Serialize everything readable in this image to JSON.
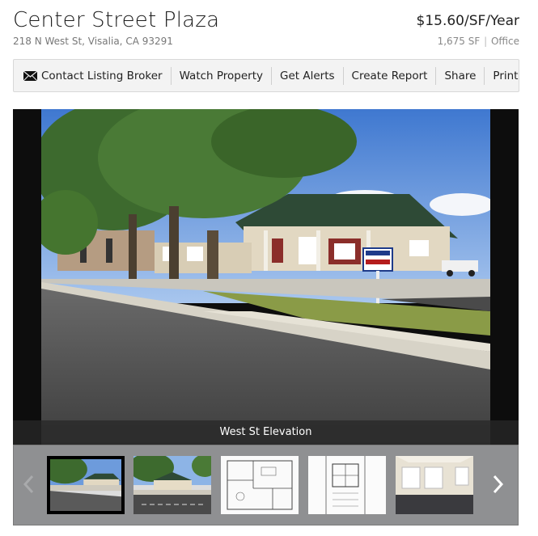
{
  "listing": {
    "title": "Center Street Plaza",
    "address": "218 N West St, Visalia, CA 93291",
    "price": "$15.60/SF/Year",
    "size": "1,675 SF",
    "meta_separator": "|",
    "type": "Office"
  },
  "toolbar": {
    "contact_label": "Contact Listing Broker",
    "watch_label": "Watch Property",
    "alerts_label": "Get Alerts",
    "report_label": "Create Report",
    "share_label": "Share",
    "print_label": "Print"
  },
  "gallery": {
    "caption": "West St Elevation",
    "thumbnails": [
      {
        "icon": "exterior-photo",
        "active": true
      },
      {
        "icon": "exterior-photo-2",
        "active": false
      },
      {
        "icon": "floor-plan",
        "active": false
      },
      {
        "icon": "site-plan",
        "active": false
      },
      {
        "icon": "interior-photo",
        "active": false
      }
    ]
  },
  "colors": {
    "toolbar_bg": "#f3f3f3",
    "gallery_bg": "#0d0d0d",
    "thumb_strip_bg": "#8f9092",
    "caption_bg": "#2b2b2b"
  }
}
